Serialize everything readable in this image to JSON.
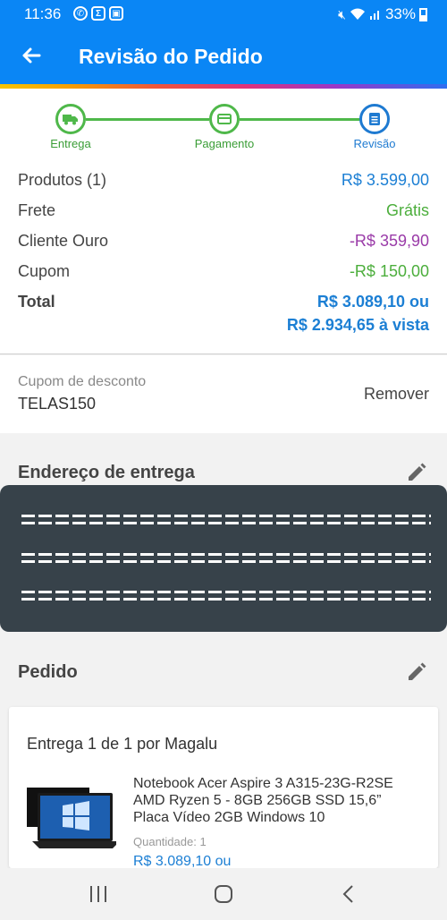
{
  "status": {
    "time": "11:36",
    "battery": "33%"
  },
  "header": {
    "title": "Revisão do Pedido"
  },
  "steps": [
    {
      "label": "Entrega"
    },
    {
      "label": "Pagamento"
    },
    {
      "label": "Revisão"
    }
  ],
  "summary": {
    "rows": [
      {
        "label": "Produtos (1)",
        "value": "R$ 3.599,00"
      },
      {
        "label": "Frete",
        "value": "Grátis"
      },
      {
        "label": "Cliente Ouro",
        "value": "-R$ 359,90"
      },
      {
        "label": "Cupom",
        "value": "-R$ 150,00"
      }
    ],
    "total_label": "Total",
    "total_value": "R$ 3.089,10 ou",
    "total_cash": "R$ 2.934,65 à vista"
  },
  "coupon": {
    "caption": "Cupom de desconto",
    "code": "TELAS150",
    "remove_label": "Remover"
  },
  "address": {
    "title": "Endereço de entrega"
  },
  "order": {
    "title": "Pedido",
    "delivery_heading": "Entrega 1 de 1 por Magalu",
    "product_name": "Notebook Acer Aspire 3 A315-23G-R2SE AMD Ryzen 5 - 8GB 256GB SSD 15,6” Placa Vídeo 2GB Windows 10",
    "quantity": "Quantidade:  1",
    "price": "R$ 3.089,10 ou"
  },
  "colors": {
    "primary": "#0a86f5",
    "step_green": "#4fb84a",
    "step_active": "#1e7ad1",
    "price_blue": "#1c7fd4",
    "free_green": "#4cae3c",
    "discount_purple": "#9a3ba8"
  }
}
